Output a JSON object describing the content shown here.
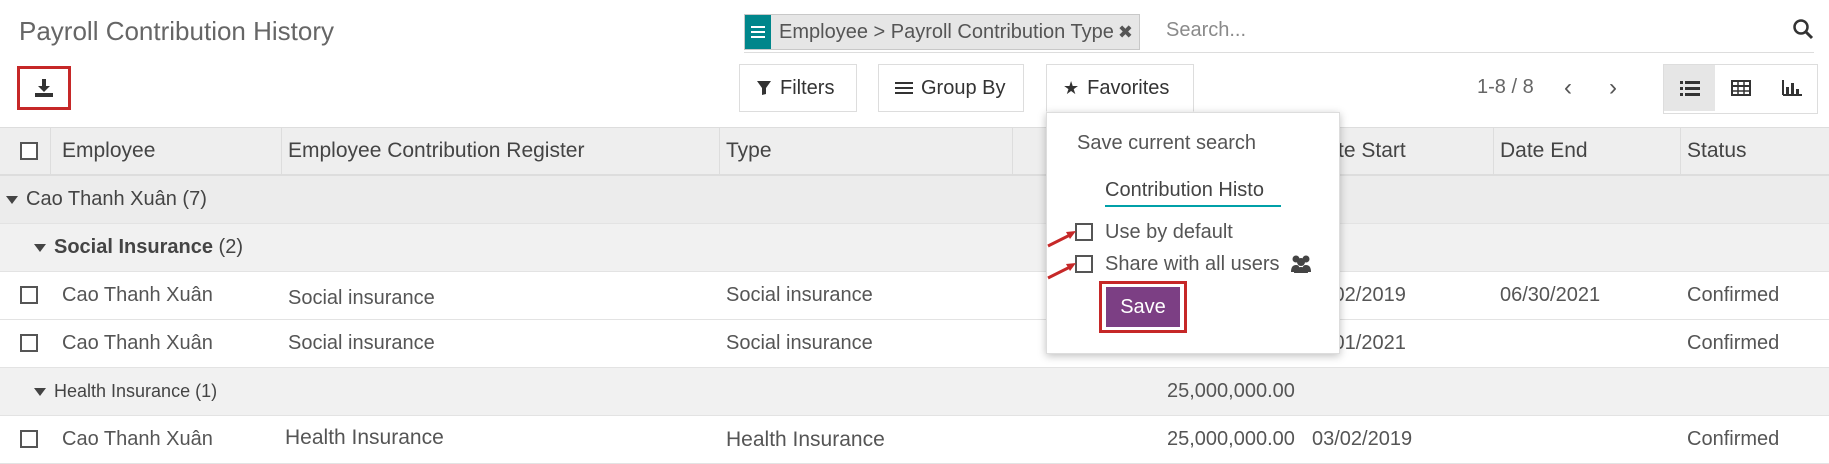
{
  "page": {
    "title": "Payroll Contribution History"
  },
  "search": {
    "facet_label": "Employee > Payroll Contribution Type",
    "placeholder": "Search..."
  },
  "toolbar": {
    "filters": "Filters",
    "group_by": "Group By",
    "favorites": "Favorites",
    "pager": "1-8 / 8"
  },
  "columns": [
    "Employee",
    "Employee Contribution Register",
    "Type",
    "te Start",
    "Date End",
    "Status"
  ],
  "groups": {
    "g1": {
      "label": "Cao Thanh Xuân (7)"
    },
    "g2": {
      "label": "Social Insurance",
      "count": "(2)"
    },
    "g3": {
      "label": "Health Insurance",
      "count": "(1)",
      "amount": "25,000,000.00"
    }
  },
  "rows": [
    {
      "employee": "Cao Thanh Xuân",
      "register": "Social insurance",
      "type": "Social insurance",
      "amount": "",
      "start": "/02/2019",
      "end": "06/30/2021",
      "status": "Confirmed"
    },
    {
      "employee": "Cao Thanh Xuân",
      "register": "Social insurance",
      "type": "Social insurance",
      "amount": "",
      "start": "/01/2021",
      "end": "",
      "status": "Confirmed"
    },
    {
      "employee": "Cao Thanh Xuân",
      "register": "Health Insurance",
      "type": "Health Insurance",
      "amount": "25,000,000.00",
      "start": "03/02/2019",
      "end": "",
      "status": "Confirmed"
    }
  ],
  "favorites_menu": {
    "save_current": "Save current search",
    "name_value": "Contribution Histo",
    "use_default": "Use by default",
    "share_all": "Share with all users",
    "save": "Save"
  },
  "colors": {
    "accent": "#00868b",
    "save": "#7c3f84",
    "highlight": "#c62828"
  }
}
